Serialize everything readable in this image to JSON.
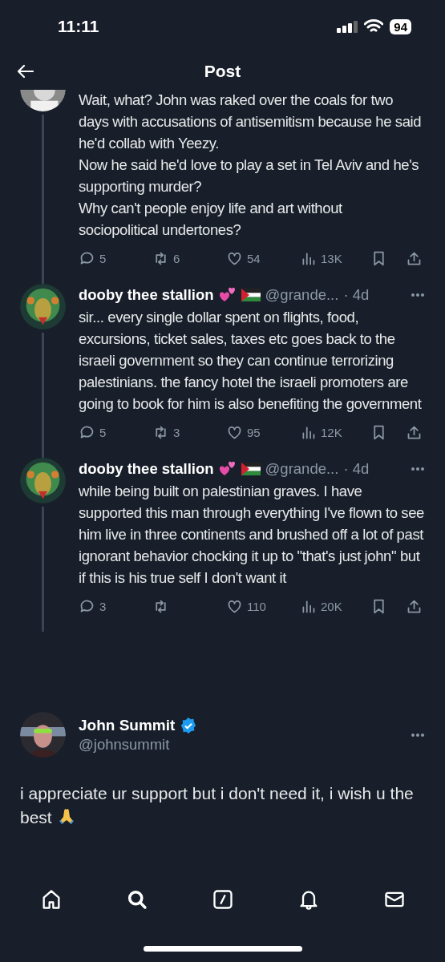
{
  "status_bar": {
    "time": "11:11",
    "battery": "94"
  },
  "header": {
    "title": "Post"
  },
  "thread": [
    {
      "kind": "clipped",
      "text": "Wait, what? John was raked over the coals for two days with accusations of antisemitism because he said he'd collab with Yeezy.\nNow he said he'd love to play a set in Tel Aviv and he's supporting murder?\nWhy can't people enjoy life and art without sociopolitical undertones?",
      "stats": {
        "replies": "5",
        "reposts": "6",
        "likes": "54",
        "views": "13K"
      }
    },
    {
      "kind": "reply",
      "name": "dooby thee stallion",
      "handle": "@grande...",
      "time": "· 4d",
      "text": "sir... every single dollar spent on flights, food, excursions, ticket sales, taxes etc goes back to the israeli government so they can continue terrorizing palestinians. the fancy hotel the israeli promoters are going to book for him is also benefiting the government",
      "stats": {
        "replies": "5",
        "reposts": "3",
        "likes": "95",
        "views": "12K"
      }
    },
    {
      "kind": "reply",
      "name": "dooby thee stallion",
      "handle": "@grande...",
      "time": "· 4d",
      "text": "while being built on palestinian graves. I have supported this man through everything I've flown to see him live in three continents and brushed off a lot of past ignorant behavior chocking it up to \"that's just john\" but if this is his true self I don't want it",
      "stats": {
        "replies": "3",
        "likes": "110",
        "views": "20K"
      }
    }
  ],
  "main_post": {
    "name": "John Summit",
    "verified": true,
    "handle": "@johnsummit",
    "text": "i appreciate ur support but i don't need it, i wish u the best"
  },
  "tab_bar": [
    {
      "kind": "home",
      "selected": false
    },
    {
      "kind": "search",
      "selected": true
    },
    {
      "kind": "compose",
      "selected": false
    },
    {
      "kind": "bell",
      "selected": false
    },
    {
      "kind": "mail",
      "selected": false
    }
  ]
}
